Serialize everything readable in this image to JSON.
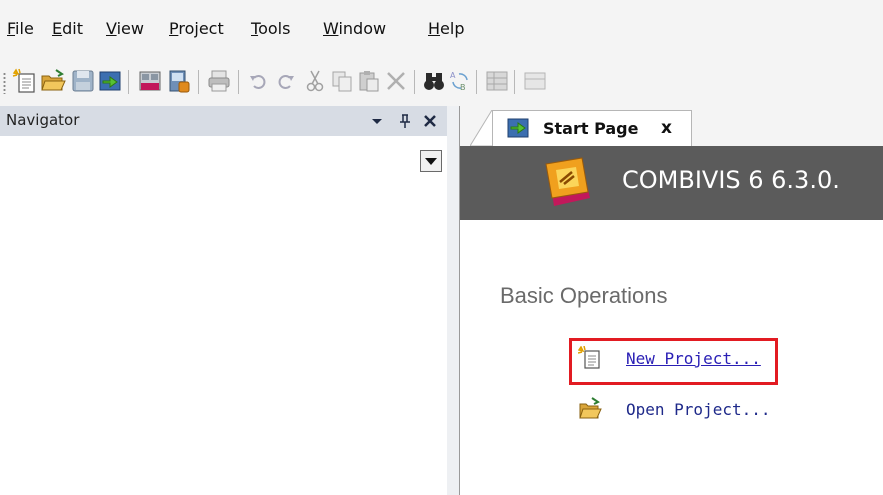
{
  "menu": {
    "items": [
      {
        "mnemonic": "F",
        "rest": "ile"
      },
      {
        "mnemonic": "E",
        "rest": "dit"
      },
      {
        "mnemonic": "V",
        "rest": "iew"
      },
      {
        "mnemonic": "P",
        "rest": "roject"
      },
      {
        "mnemonic": "T",
        "rest": "ools"
      },
      {
        "mnemonic": "W",
        "rest": "indow"
      },
      {
        "mnemonic": "H",
        "rest": "elp"
      }
    ]
  },
  "navigator": {
    "title": "Navigator"
  },
  "tabs": [
    {
      "label": "Start Page",
      "close": "x"
    }
  ],
  "banner": {
    "title": "COMBIVIS 6 6.3.0."
  },
  "start_page": {
    "section_title": "Basic Operations",
    "links": {
      "new_project": "New Project...",
      "open_project": "Open Project..."
    }
  },
  "colors": {
    "highlight": "#e21b22",
    "link": "#2a1fb5",
    "banner": "#5b5b5b",
    "panel_header": "#d7dce4"
  }
}
